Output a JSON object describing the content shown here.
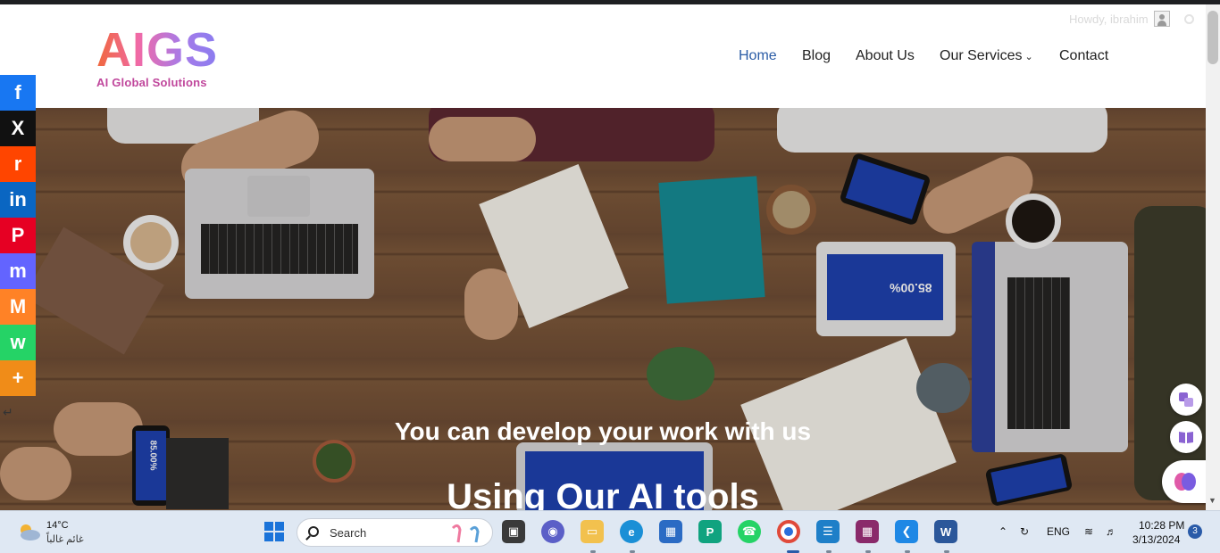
{
  "site": {
    "logo_mark": "AIGS",
    "logo_sub": "AI Global Solutions",
    "howdy": "Howdy, ibrahim"
  },
  "nav": [
    {
      "label": "Home",
      "active": true
    },
    {
      "label": "Blog"
    },
    {
      "label": "About Us"
    },
    {
      "label": "Our Services",
      "dropdown": true
    },
    {
      "label": "Contact"
    }
  ],
  "hero": {
    "line1": "You can develop your work with us",
    "line2": "Using Our AI tools",
    "tablet_screen_text": "85.00%",
    "phone_screen_text": "85.00%"
  },
  "share": [
    {
      "name": "facebook",
      "glyph": "f",
      "color": "#1877f2"
    },
    {
      "name": "x",
      "glyph": "X",
      "color": "#111111"
    },
    {
      "name": "reddit",
      "glyph": "r",
      "color": "#ff4500"
    },
    {
      "name": "linkedin",
      "glyph": "in",
      "color": "#0a66c2"
    },
    {
      "name": "pinterest",
      "glyph": "P",
      "color": "#e60023"
    },
    {
      "name": "mastodon",
      "glyph": "m",
      "color": "#6364ff"
    },
    {
      "name": "mix",
      "glyph": "M",
      "color": "#ff8226"
    },
    {
      "name": "whatsapp",
      "glyph": "w",
      "color": "#25d366"
    },
    {
      "name": "more",
      "glyph": "+",
      "color": "#f08c18"
    }
  ],
  "taskbar": {
    "temp": "14°C",
    "weather": "غائم غالباً",
    "search_label": "Search",
    "lang": "ENG",
    "time": "10:28 PM",
    "date": "3/13/2024",
    "notifications": "3"
  },
  "colors": {
    "accent": "#2b5ca6",
    "taskbar": "#dfe8f3"
  }
}
